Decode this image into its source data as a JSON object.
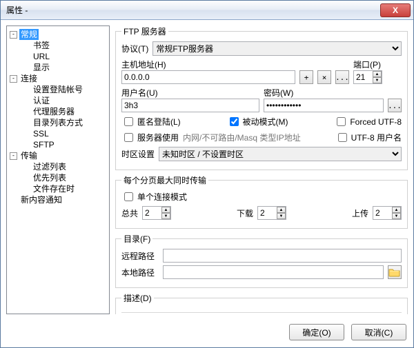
{
  "window": {
    "title": "属性 -"
  },
  "tree": {
    "n0": {
      "label": "常规",
      "toggle": "-"
    },
    "n1": {
      "label": "书签"
    },
    "n2": {
      "label": "URL"
    },
    "n3": {
      "label": "显示"
    },
    "n4": {
      "label": "连接",
      "toggle": "-"
    },
    "n5": {
      "label": "设置登陆帐号"
    },
    "n6": {
      "label": "认证"
    },
    "n7": {
      "label": "代理服务器"
    },
    "n8": {
      "label": "目录列表方式"
    },
    "n9": {
      "label": "SSL"
    },
    "n10": {
      "label": "SFTP"
    },
    "n11": {
      "label": "传输",
      "toggle": "-"
    },
    "n12": {
      "label": "过滤列表"
    },
    "n13": {
      "label": "优先列表"
    },
    "n14": {
      "label": "文件存在时"
    },
    "n15": {
      "label": "新内容通知"
    }
  },
  "server": {
    "legend": "FTP 服务器",
    "protocol_label": "协议(T)",
    "protocol_value": "常规FTP服务器",
    "host_label": "主机地址(H)",
    "host_value": "0.0.0.0",
    "port_label": "端口(P)",
    "port_value": "21",
    "user_label": "用户名(U)",
    "user_value": "3h3",
    "pass_label": "密码(W)",
    "pass_value": "************",
    "anon_label": "匿名登陆(L)",
    "pasv_label": "被动模式(M)",
    "forced_label": "Forced UTF-8",
    "masq_cb_label": "服务器使用",
    "masq_text": "内网/不可路由/Masq 类型IP地址",
    "utf8user_label": "UTF-8 用户名",
    "tz_label": "时区设置",
    "tz_value": "未知时区 / 不设置时区"
  },
  "transfer": {
    "legend": "每个分页最大同时传输",
    "single_label": "单个连接模式",
    "total_label": "总共",
    "total_value": "2",
    "down_label": "下载",
    "down_value": "2",
    "up_label": "上传",
    "up_value": "2"
  },
  "path": {
    "legend": "目录(F)",
    "remote_label": "远程路径",
    "remote_value": "",
    "local_label": "本地路径",
    "local_value": ""
  },
  "desc": {
    "legend": "描述(D)"
  },
  "buttons": {
    "plus": "+",
    "x": "×",
    "dots": "...",
    "ok": "确定(O)",
    "cancel": "取消(C)"
  },
  "icons": {
    "close": "X"
  }
}
